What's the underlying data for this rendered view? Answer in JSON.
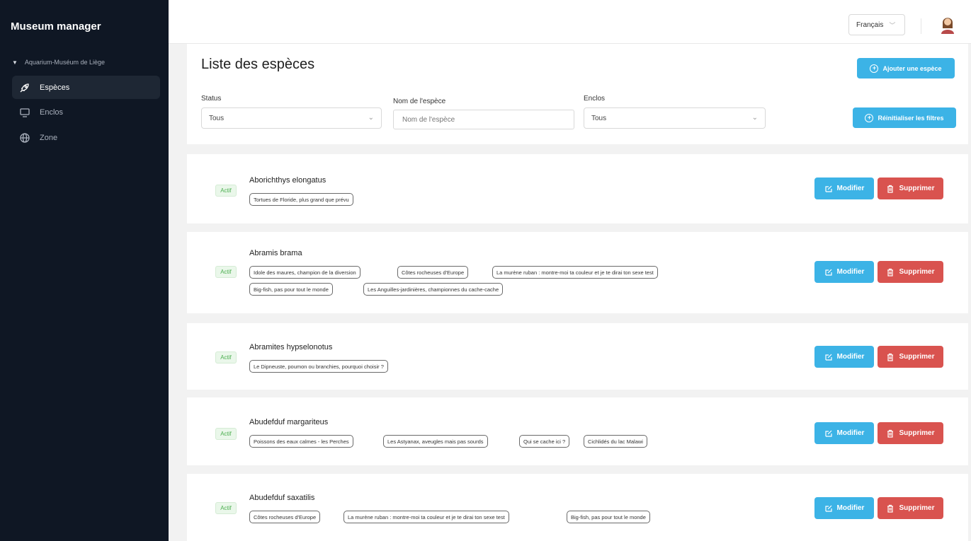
{
  "sidebar": {
    "brand": "Museum manager",
    "tree_label": "Aquarium-Muséum de Liège",
    "items": [
      {
        "label": "Espèces",
        "icon": "rocket-icon",
        "active": true
      },
      {
        "label": "Enclos",
        "icon": "monitor-icon",
        "active": false
      },
      {
        "label": "Zone",
        "icon": "globe-icon",
        "active": false
      }
    ]
  },
  "header": {
    "language": "Français"
  },
  "page": {
    "title": "Liste des espèces",
    "add_button": "Ajouter une espèce",
    "reset_button": "Réinitialiser les filtres",
    "filters": {
      "status_label": "Status",
      "status_value": "Tous",
      "name_label": "Nom de l'espèce",
      "name_placeholder": "Nom de l'espèce",
      "enclos_label": "Enclos",
      "enclos_value": "Tous"
    }
  },
  "species": [
    {
      "name": "Aborichthys elongatus",
      "status": "Actif",
      "tags": [
        "Tortues de Floride, plus grand que prévu"
      ]
    },
    {
      "name": "Abramis brama",
      "status": "Actif",
      "tags": [
        "Idole des maures, champion de la diversion",
        "Côtes rocheuses d'Europe",
        "La murène ruban : montre-moi ta couleur et je te dirai ton sexe test",
        "Big-fish, pas pour tout le monde",
        "Les Anguilles-jardinières, championnes du cache-cache"
      ]
    },
    {
      "name": "Abramites hypselonotus",
      "status": "Actif",
      "tags": [
        "Le Dipneuste, poumon ou branchies, pourquoi choisir ?"
      ]
    },
    {
      "name": "Abudefduf margariteus",
      "status": "Actif",
      "tags": [
        "Poissons des eaux calmes - les Perches",
        "Les Astyanax, aveugles mais pas sourds",
        "Qui se cache ici ?",
        "Cichlidés du lac Malawi"
      ]
    },
    {
      "name": "Abudefduf saxatilis",
      "status": "Actif",
      "tags": [
        "Côtes rocheuses d'Europe",
        "La murène ruban : montre-moi ta couleur et je te dirai ton sexe test",
        "Big-fish, pas pour tout le monde"
      ]
    }
  ],
  "actions": {
    "edit": "Modifier",
    "delete": "Supprimer"
  }
}
